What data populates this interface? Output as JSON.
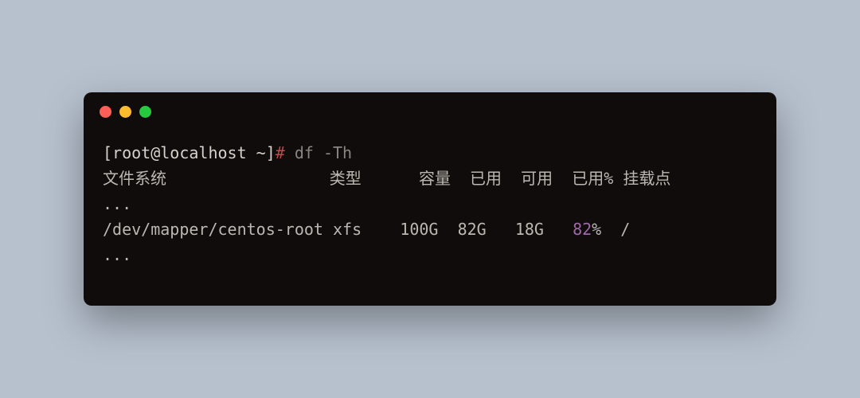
{
  "prompt": {
    "user_host": "[root@localhost ~]",
    "hash": "#",
    "command": "df -Th"
  },
  "headers": {
    "filesystem": "文件系统",
    "type": "类型",
    "size": "容量",
    "used": "已用",
    "avail": "可用",
    "use_pct": "已用%",
    "mount": "挂载点"
  },
  "ellipsis": "...",
  "row": {
    "filesystem": "/dev/mapper/centos-root",
    "type": "xfs",
    "size": "100G",
    "used": "82G",
    "avail": "18G",
    "use_pct_num": "82",
    "use_pct_sym": "%",
    "mount": "/"
  },
  "chart_data": {
    "type": "table",
    "title": "df -Th output",
    "columns": [
      "文件系统",
      "类型",
      "容量",
      "已用",
      "可用",
      "已用%",
      "挂载点"
    ],
    "rows": [
      {
        "filesystem": "/dev/mapper/centos-root",
        "type": "xfs",
        "size": "100G",
        "used": "82G",
        "avail": "18G",
        "use_pct": "82%",
        "mount": "/"
      }
    ]
  }
}
